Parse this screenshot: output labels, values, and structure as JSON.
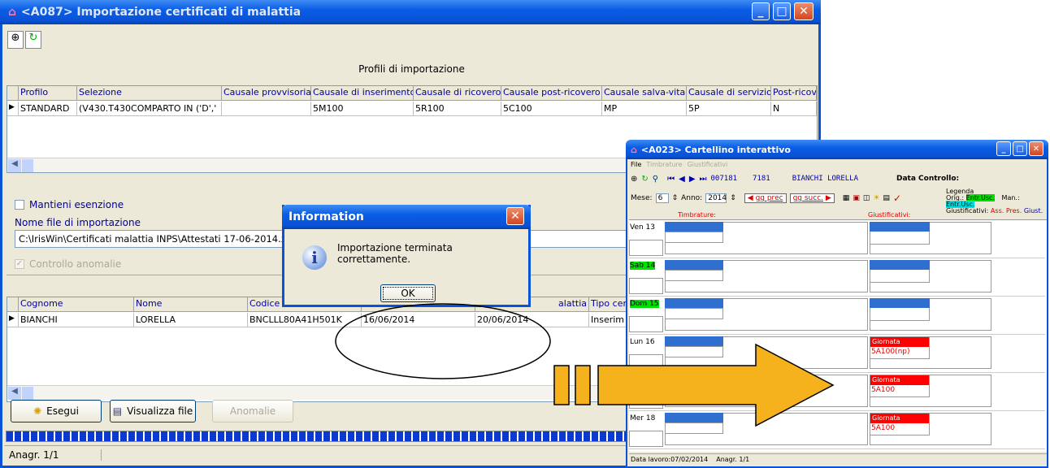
{
  "main_window": {
    "title": "<A087> Importazione certificati di malattia",
    "profiles_heading": "Profili di importazione",
    "profile_columns": [
      "Profilo",
      "Selezione",
      "Causale provvisoria",
      "Causale di inserimento",
      "Causale di ricovero",
      "Causale post-ricovero",
      "Causale salva-vita",
      "Causale di servizio",
      "Post-ricov"
    ],
    "profile_row": [
      "STANDARD",
      "(V430.T430COMPARTO IN ('D','",
      "",
      "5M100",
      "5R100",
      "5C100",
      "MP",
      "5P",
      "N"
    ],
    "checkbox_exemption": "Mantieni esenzione",
    "file_label": "Nome file di importazione",
    "file_value": "C:\\IrisWin\\Certificati malattia INPS\\Attestati 17-06-2014.xml",
    "checkbox_anomalies": "Controllo anomalie",
    "cert_columns": [
      "Cognome",
      "Nome",
      "Codice f",
      "",
      "",
      "alattia",
      "Tipo cer"
    ],
    "cert_row": [
      "BIANCHI",
      "LORELLA",
      "BNCLLL80A41H501K",
      "16/06/2014",
      "20/06/2014",
      "Inserim"
    ],
    "btn_run": "Esegui",
    "btn_view": "Visualizza file",
    "btn_anomalies": "Anomalie",
    "status": "Anagr. 1/1"
  },
  "dialog": {
    "title": "Information",
    "message": "Importazione terminata correttamente.",
    "ok": "OK"
  },
  "card_window": {
    "title": "<A023> Cartellino interattivo",
    "menu": [
      "File",
      "Timbrature",
      "Giustificativi"
    ],
    "emp_code": "007181",
    "emp_badge": "7181",
    "emp_name": "BIANCHI LORELLA",
    "data_controllo": "Data Controllo:",
    "mese_label": "Mese:",
    "mese_value": "6",
    "anno_label": "Anno:",
    "anno_value": "2014",
    "gg_prec": "gg prec",
    "gg_succ": "gg succ.",
    "legend_title": "Legenda",
    "legend_orig": "Orig.:",
    "legend_man": "Man.:",
    "legend_entusc": "Entr.Usc.",
    "legend_giust": "Giustificativi:",
    "legend_ass": "Ass.",
    "legend_pres": "Pres.",
    "legend_giust2": "Giust.",
    "col_timbrature": "Timbrature:",
    "col_giustificativi": "Giustificativi:",
    "days": [
      {
        "label": "Ven 13",
        "highlight": false,
        "giust_name": "",
        "giust_code": ""
      },
      {
        "label": "Sab 14",
        "highlight": true,
        "giust_name": "",
        "giust_code": ""
      },
      {
        "label": "Dom 15",
        "highlight": true,
        "giust_name": "",
        "giust_code": ""
      },
      {
        "label": "Lun 16",
        "highlight": false,
        "giust_name": "Giornata",
        "giust_code": "5A100(np)"
      },
      {
        "label": "",
        "highlight": false,
        "giust_name": "Giornata",
        "giust_code": "5A100"
      },
      {
        "label": "Mer 18",
        "highlight": false,
        "giust_name": "Giornata",
        "giust_code": "5A100"
      }
    ],
    "status_date": "Data lavoro:07/02/2014",
    "status_anagr": "Anagr. 1/1"
  },
  "colors": {
    "titlebar": "#0a52d6",
    "progress": "#0a3ad0",
    "arrow": "#f5b21c",
    "legend_green": "#00e000",
    "legend_cyan": "#00e0e0"
  }
}
